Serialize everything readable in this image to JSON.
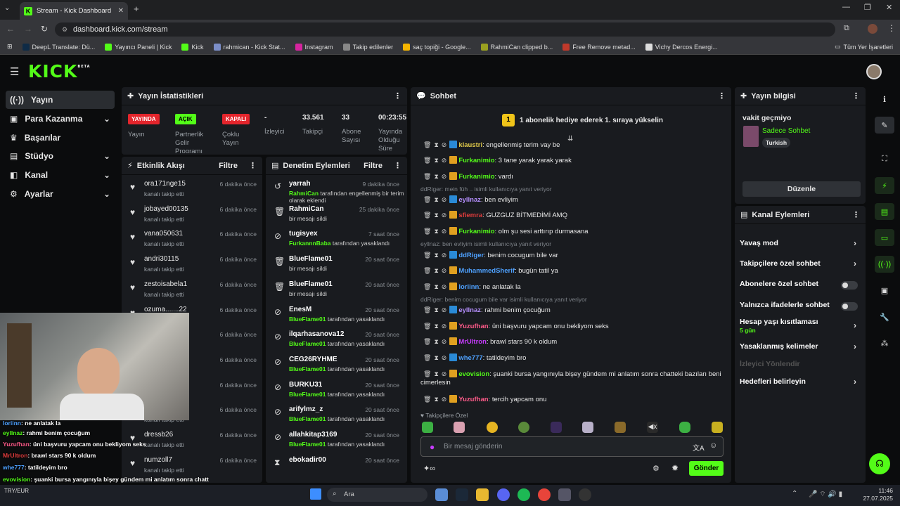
{
  "browser": {
    "tab_title": "Stream - Kick Dashboard",
    "url": "dashboard.kick.com/stream",
    "bookmarks": [
      "DeepL Translate: Dü...",
      "Yayıncı Paneli | Kick",
      "Kick",
      "rahmican - Kick Stat...",
      "Instagram",
      "Takip edilenler",
      "saç topiği - Google...",
      "RahmiCan clipped b...",
      "Free Remove metad...",
      "Vichy Dercos Energi..."
    ],
    "all_bookmarks": "Tüm Yer İşaretleri"
  },
  "header": {
    "logo": "KICK",
    "beta": "BETA"
  },
  "sidebar": [
    {
      "label": "Yayın",
      "icon": "broadcast-icon"
    },
    {
      "label": "Para Kazanma",
      "icon": "money-icon"
    },
    {
      "label": "Başarılar",
      "icon": "trophy-icon"
    },
    {
      "label": "Stüdyo",
      "icon": "studio-icon"
    },
    {
      "label": "Kanal",
      "icon": "channel-icon"
    },
    {
      "label": "Ayarlar",
      "icon": "gear-icon"
    }
  ],
  "stats": {
    "title": "Yayın İstatistikleri",
    "items": [
      {
        "badge": "YAYINDA",
        "label": "Yayın"
      },
      {
        "badge": "AÇIK",
        "label": "Partnerlik Gelir Programı"
      },
      {
        "badge": "KAPALI",
        "label": "Çoklu Yayın"
      },
      {
        "value": "-",
        "label": "İzleyici"
      },
      {
        "value": "33.561",
        "label": "Takipçi"
      },
      {
        "value": "33",
        "label": "Abone Sayısı"
      },
      {
        "value": "00:23:55",
        "label": "Yayında Olduğu Süre"
      }
    ]
  },
  "activity": {
    "title": "Etkinlik Akışı",
    "filter": "Filtre",
    "sub": "kanalı takip etti",
    "time": "6 dakika önce",
    "names": [
      "ora171nge15",
      "jobayed00135",
      "vana050631",
      "andri30115",
      "zestoisabela1",
      "ozuma.......22",
      "",
      "",
      "",
      "",
      "dressb26",
      "numzoll7"
    ]
  },
  "mod": {
    "title": "Denetim Eylemleri",
    "filter": "Filtre",
    "items": [
      {
        "name": "yarrah",
        "time": "9 dakika önce",
        "by": "RahmiCan",
        "text": "tarafından engellenmiş bir terim olarak eklendi",
        "icon": "undo-icon"
      },
      {
        "name": "RahmiCan",
        "time": "25 dakika önce",
        "by": "",
        "text": "bir mesajı sildi",
        "icon": "trash-icon"
      },
      {
        "name": "tugisyex",
        "time": "7 saat önce",
        "by": "FurkannnBaba",
        "text": "tarafından yasaklandı",
        "icon": "ban-icon"
      },
      {
        "name": "BlueFlame01",
        "time": "20 saat önce",
        "by": "",
        "text": "bir mesajı sildi",
        "icon": "trash-icon"
      },
      {
        "name": "BlueFlame01",
        "time": "20 saat önce",
        "by": "",
        "text": "bir mesajı sildi",
        "icon": "trash-icon"
      },
      {
        "name": "EnesM",
        "time": "20 saat önce",
        "by": "BlueFlame01",
        "text": "tarafından yasaklandı",
        "icon": "ban-icon"
      },
      {
        "name": "ilqarhasanova12",
        "time": "20 saat önce",
        "by": "BlueFlame01",
        "text": "tarafından yasaklandı",
        "icon": "ban-icon"
      },
      {
        "name": "CEG26RYHME",
        "time": "20 saat önce",
        "by": "BlueFlame01",
        "text": "tarafından yasaklandı",
        "icon": "ban-icon"
      },
      {
        "name": "BURKU31",
        "time": "20 saat önce",
        "by": "BlueFlame01",
        "text": "tarafından yasaklandı",
        "icon": "ban-icon"
      },
      {
        "name": "arifylmz_z",
        "time": "20 saat önce",
        "by": "BlueFlame01",
        "text": "tarafından yasaklandı",
        "icon": "ban-icon"
      },
      {
        "name": "allahkitap3169",
        "time": "20 saat önce",
        "by": "BlueFlame01",
        "text": "tarafından yasaklandı",
        "icon": "ban-icon"
      },
      {
        "name": "ebokadir00",
        "time": "20 saat önce",
        "by": "",
        "text": "",
        "icon": "hourglass-icon"
      }
    ]
  },
  "chat": {
    "title": "Sohbet",
    "promo_num": "1",
    "promo": "1 abonelik hediye ederek 1. sıraya yükselin",
    "messages": [
      {
        "reply": "",
        "user": "klaustri",
        "color": "#e0c94a",
        "text": ": engellenmiş terim vay be"
      },
      {
        "reply": "",
        "user": "Furkanimio",
        "color": "#53fc18",
        "text": ": 3 tane yarak yarak yarak"
      },
      {
        "reply": "",
        "user": "Furkanimio",
        "color": "#53fc18",
        "text": ": vardı"
      },
      {
        "reply": "ddRiger: mein füh .. isimli kullanıcıya yanıt veriyor",
        "user": "eyllnaz",
        "color": "#b690ff",
        "text": ": ben evliyim"
      },
      {
        "reply": "",
        "user": "sfiemra",
        "color": "#e03c3c",
        "text": ": GUZGUZ BİTMEDİMİ AMQ"
      },
      {
        "reply": "",
        "user": "Furkanimio",
        "color": "#53fc18",
        "text": ": olm şu sesi arttırıp durmasana"
      },
      {
        "reply": "eyllnaz: ben evliyim isimli kullanıcıya yanıt veriyor",
        "user": "ddRiger",
        "color": "#4ea1ff",
        "text": ": benim cocugum bile var"
      },
      {
        "reply": "",
        "user": "MuhammedSherif",
        "color": "#4ea1ff",
        "text": ": bugün tatil ya"
      },
      {
        "reply": "",
        "user": "loriinn",
        "color": "#4ea1ff",
        "text": ": ne anlatak la"
      },
      {
        "reply": "ddRiger: benim cocugum bile var isimli kullanıcıya yanıt veriyor",
        "user": "eyllnaz",
        "color": "#b690ff",
        "text": ": rahmi benim çocuğum"
      },
      {
        "reply": "",
        "user": "Yuzufhan",
        "color": "#ff5b8a",
        "text": ": üni başvuru yapcam onu bekliyom seks"
      },
      {
        "reply": "",
        "user": "MrUltron",
        "color": "#c83cff",
        "text": ": brawl stars 90 k oldum"
      },
      {
        "reply": "",
        "user": "whe777",
        "color": "#4ea1ff",
        "text": ": tatildeyim bro"
      },
      {
        "reply": "",
        "user": "evovision",
        "color": "#53fc18",
        "text": ": şuanki bursa yangınıyla bişey gündem mi anlatım sonra chatteki bazıları beni cimerlesin"
      },
      {
        "reply": "",
        "user": "Yuzufhan",
        "color": "#ff5b8a",
        "text": ": tercih yapcam onu"
      }
    ],
    "followers_only": "Takipçilere Özel",
    "placeholder": "Bir mesaj gönderin",
    "send": "Gönder"
  },
  "info": {
    "title": "Yayın bilgisi",
    "stream_title": "vakit geçmiyo",
    "category": "Sadece Sohbet",
    "tag": "Turkish",
    "edit": "Düzenle"
  },
  "channel_actions": {
    "title": "Kanal Eylemleri",
    "items": [
      {
        "label": "Yavaş mod",
        "kind": "chev"
      },
      {
        "label": "Takipçilere özel sohbet",
        "kind": "chev"
      },
      {
        "label": "Abonelere özel sohbet",
        "kind": "toggle"
      },
      {
        "label": "Yalnızca ifadelerle sohbet",
        "kind": "toggle"
      },
      {
        "label": "Hesap yaşı kısıtlaması",
        "kind": "chev",
        "sub": "5 gün"
      },
      {
        "label": "Yasaklanmış kelimeler",
        "kind": "chev"
      },
      {
        "label": "İzleyici Yönlendir",
        "kind": "disabled"
      },
      {
        "label": "Hedefleri belirleyin",
        "kind": "chev"
      }
    ]
  },
  "overlay": {
    "lines": [
      {
        "user": "loriinn",
        "color": "#4ea1ff",
        "text": ": ne anlatak la"
      },
      {
        "user": "eyllnaz",
        "color": "#53fc18",
        "text": ": rahmi benim çocuğum"
      },
      {
        "user": "Yuzufhan",
        "color": "#ff5b8a",
        "text": ": üni başvuru yapcam onu bekliyom seks"
      },
      {
        "user": "MrUltron",
        "color": "#e03c3c",
        "text": ": brawl stars 90 k oldum"
      },
      {
        "user": "whe777",
        "color": "#4ea1ff",
        "text": ": tatildeyim bro"
      },
      {
        "user": "evovision",
        "color": "#53fc18",
        "text": ": şuanki bursa yangınıyla bişey gündem mi anlatım sonra chatt"
      },
      {
        "user": "",
        "color": "#ffffff",
        "text": "cimerlesin"
      },
      {
        "user": "Yuzufhan",
        "color": "#ff5b8a",
        "text": ": tercih yapcam onu"
      }
    ]
  },
  "taskbar": {
    "search": "Ara",
    "currency": "TRY/EUR",
    "time": "11:46",
    "date": "27.07.2025"
  },
  "colors": {
    "accent": "#53fc18",
    "panel": "#191b1f",
    "bg": "#0b0c0d"
  }
}
